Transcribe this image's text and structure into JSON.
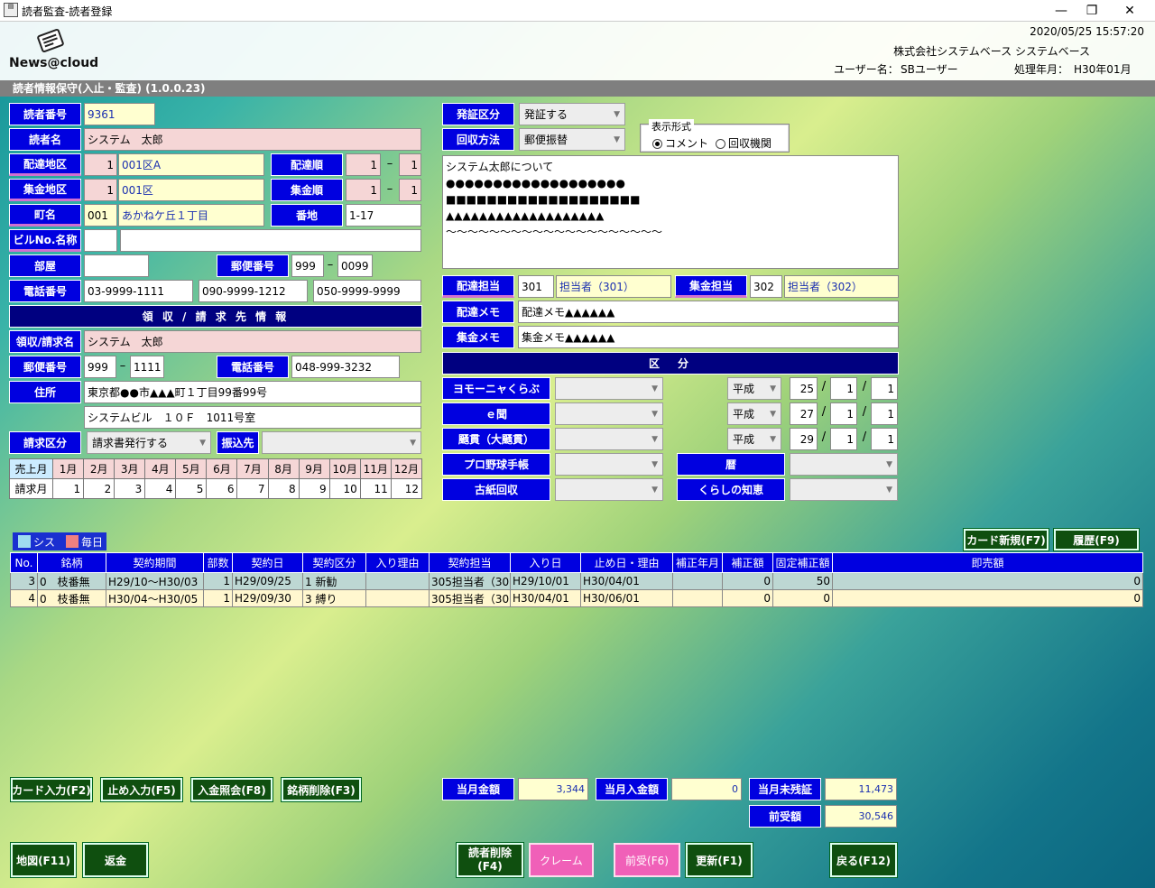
{
  "window": {
    "title": "読者監査-読者登録",
    "app_icon": "news-icon"
  },
  "header": {
    "logo": "News@cloud",
    "datetime": "2020/05/25 15:57:20",
    "company": "株式会社システムベース システムベース",
    "user_label": "ユーザー名：",
    "user": "SBユーザー",
    "period_label": "処理年月：",
    "period": "H30年01月"
  },
  "subtitle": "読者情報保守(入止・監査) (1.0.0.23)",
  "reader": {
    "no_label": "読者番号",
    "no": "9361",
    "name_label": "読者名",
    "name": "システム　太郎",
    "area_label": "配達地区",
    "area_code": "1",
    "area_name": "001区A",
    "order_label": "配達順",
    "order_a": "1",
    "order_b": "1",
    "col_area_label": "集金地区",
    "col_area_code": "1",
    "col_area_name": "001区",
    "col_order_label": "集金順",
    "col_order_a": "1",
    "col_order_b": "1",
    "town_label": "町名",
    "town_code": "001",
    "town_name": "あかねケ丘１丁目",
    "banchi_label": "番地",
    "banchi": "1-17",
    "bldg_label": "ビルNo.名称",
    "bldg_no": "",
    "bldg_name": "",
    "room_label": "部屋",
    "room": "",
    "zip_label": "郵便番号",
    "zip1": "999",
    "zip2": "0099",
    "tel_label": "電話番号",
    "tel1": "03-9999-1111",
    "tel2": "090-9999-1212",
    "tel3": "050-9999-9999",
    "dash": "–"
  },
  "billing": {
    "band": "領 収 / 請 求 先 情 報",
    "name_label": "領収/請求名",
    "name": "システム　太郎",
    "zip_label": "郵便番号",
    "zip1": "999",
    "zip2": "1111",
    "tel_label": "電話番号",
    "tel": "048-999-3232",
    "addr_label": "住所",
    "addr1": "東京都●●市▲▲▲町１丁目99番99号",
    "addr2": "システムビル　１０Ｆ　1011号室",
    "kubun_label": "請求区分",
    "kubun": "請求書発行する",
    "bank_label": "振込先",
    "bank": ""
  },
  "months": {
    "sales_label": "売上月",
    "bill_label": "請求月",
    "headers": [
      "1月",
      "2月",
      "3月",
      "4月",
      "5月",
      "6月",
      "7月",
      "8月",
      "9月",
      "10月",
      "11月",
      "12月"
    ],
    "values": [
      "1",
      "2",
      "3",
      "4",
      "5",
      "6",
      "7",
      "8",
      "9",
      "10",
      "11",
      "12"
    ]
  },
  "right": {
    "hassho_label": "発証区分",
    "hassho": "発証する",
    "kaishu_label": "回収方法",
    "kaishu": "郵便振替",
    "display_group": "表示形式",
    "radio1": "コメント",
    "radio2": "回収機関",
    "comment": [
      "システム太郎について",
      "●●●●●●●●●●●●●●●●●●●",
      "■■■■■■■■■■■■■■■■■■■",
      "▲▲▲▲▲▲▲▲▲▲▲▲▲▲▲▲▲▲▲",
      "～～～～～～～～～～～～～～～～～～～～"
    ],
    "haitatsu_tanto_label": "配達担当",
    "haitatsu_tanto_code": "301",
    "haitatsu_tanto": "担当者（301）",
    "shukin_tanto_label": "集金担当",
    "shukin_tanto_code": "302",
    "shukin_tanto": "担当者（302）",
    "haitatsu_memo_label": "配達メモ",
    "haitatsu_memo": "配達メモ▲▲▲▲▲▲",
    "shukin_memo_label": "集金メモ",
    "shukin_memo": "集金メモ▲▲▲▲▲▲",
    "band": "区　分",
    "rows": [
      {
        "label": "ヨモーニャくらぶ",
        "era": "平成",
        "y": "25",
        "m": "1",
        "d": "1"
      },
      {
        "label": "ｅ聞",
        "era": "平成",
        "y": "27",
        "m": "1",
        "d": "1"
      },
      {
        "label": "颾貫（大颾貫）",
        "era": "平成",
        "y": "29",
        "m": "1",
        "d": "1"
      }
    ],
    "baseball_label": "プロ野球手帳",
    "koyomi_label": "暦",
    "koshi_label": "古紙回収",
    "kurashi_label": "くらしの知恵",
    "slash": "/"
  },
  "legend": {
    "sys": "シス",
    "mainichi": "毎日"
  },
  "buttons": {
    "card_new": "カード新規(F7)",
    "history": "履歴(F9)",
    "card_input": "カード入力(F2)",
    "stop_input": "止め入力(F5)",
    "payment": "入金照会(F8)",
    "delete_brand": "銘柄削除(F3)",
    "map": "地図(F11)",
    "refund": "返金",
    "delete_reader": "読者削除\n(F4)",
    "claim": "クレーム",
    "prepay": "前受(F6)",
    "update": "更新(F1)",
    "back": "戻る(F12)"
  },
  "contracts": {
    "headers": [
      "No.",
      "銘柄",
      "契約期間",
      "部数",
      "契約日",
      "契約区分",
      "入り理由",
      "契約担当",
      "入り日",
      "止め日・理由",
      "補正年月",
      "補正額",
      "固定補正額",
      "即売額"
    ],
    "rows": [
      [
        "3",
        "0　枝番無",
        "H29/10～H30/03",
        "1",
        "H29/09/25",
        "1 新勧",
        "",
        "305担当者（30",
        "H29/10/01",
        "H30/04/01",
        "",
        "0",
        "50",
        "0"
      ],
      [
        "4",
        "0　枝番無",
        "H30/04～H30/05",
        "1",
        "H29/09/30",
        "3 縛り",
        "",
        "305担当者（30",
        "H30/04/01",
        "H30/06/01",
        "",
        "0",
        "0",
        "0"
      ]
    ]
  },
  "totals": {
    "month_amount_label": "当月金額",
    "month_amount": "3,344",
    "month_paid_label": "当月入金額",
    "month_paid": "0",
    "unpaid_label": "当月未残証",
    "unpaid": "11,473",
    "prepaid_label": "前受額",
    "prepaid": "30,546"
  }
}
